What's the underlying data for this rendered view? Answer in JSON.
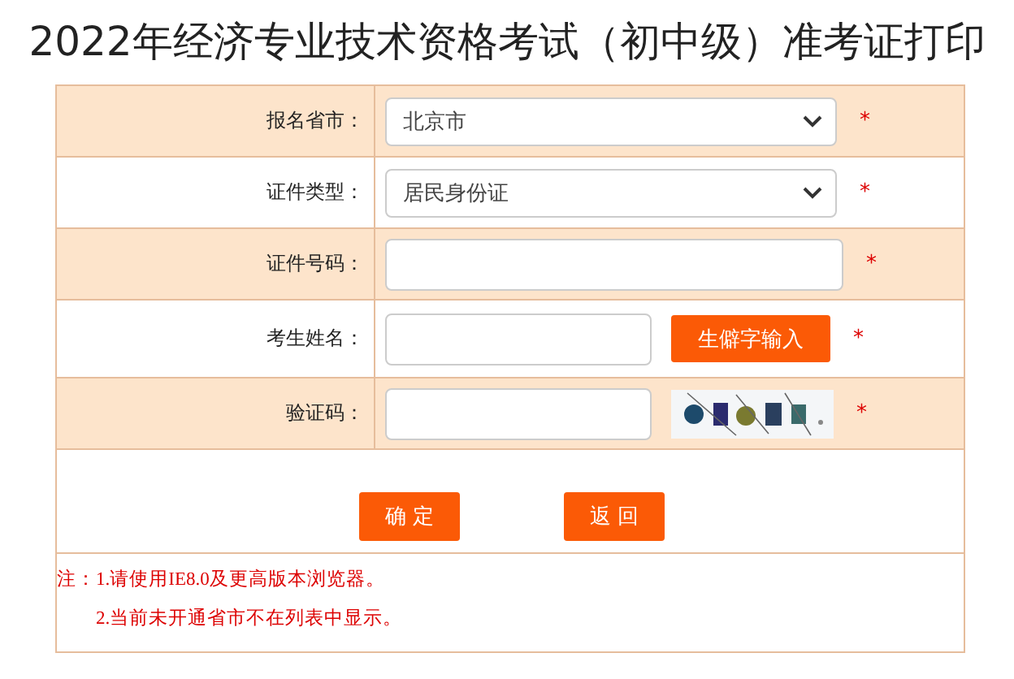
{
  "title": "2022年经济专业技术资格考试（初中级）准考证打印",
  "fields": [
    {
      "kind": "select",
      "label": "报名省市：",
      "value": "北京市",
      "required_mark": "*"
    },
    {
      "kind": "select",
      "label": "证件类型：",
      "value": "居民身份证",
      "required_mark": "*"
    },
    {
      "kind": "input",
      "label": "证件号码：",
      "required_mark": "*"
    },
    {
      "kind": "input_button",
      "label": "考生姓名：",
      "button": "生僻字输入",
      "required_mark": "*"
    },
    {
      "kind": "captcha",
      "label": "验证码：",
      "required_mark": "*"
    }
  ],
  "buttons": [
    "确 定",
    "返 回"
  ],
  "notes": [
    "注：1.请使用IE8.0及更高版本浏览器。",
    "2.当前未开通省市不在列表中显示。"
  ]
}
